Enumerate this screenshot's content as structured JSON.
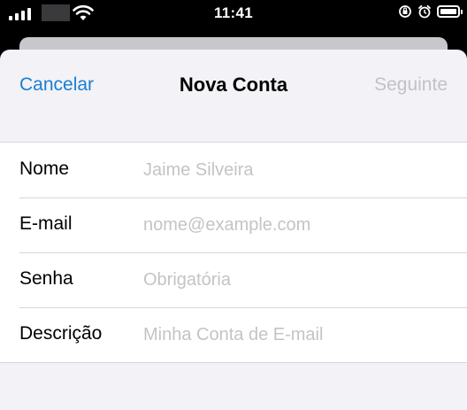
{
  "status_bar": {
    "time": "11:41",
    "icons": [
      "signal-icon",
      "wifi-icon",
      "orientation-lock-icon",
      "alarm-icon",
      "battery-icon"
    ]
  },
  "nav": {
    "cancel_label": "Cancelar",
    "title": "Nova Conta",
    "next_label": "Seguinte"
  },
  "form": {
    "fields": [
      {
        "label": "Nome",
        "value": "",
        "placeholder": "Jaime Silveira"
      },
      {
        "label": "E-mail",
        "value": "",
        "placeholder": "nome@example.com"
      },
      {
        "label": "Senha",
        "value": "",
        "placeholder": "Obrigatória"
      },
      {
        "label": "Descrição",
        "value": "",
        "placeholder": "Minha Conta de E-mail"
      }
    ]
  },
  "colors": {
    "accent": "#1a7fd1",
    "disabled": "#c2c2c6",
    "placeholder": "#c4c4c8",
    "sheet_background": "#f2f2f7"
  }
}
